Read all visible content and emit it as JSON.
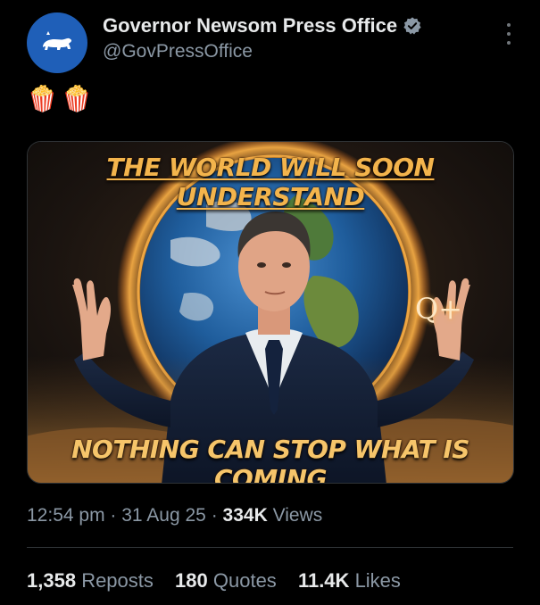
{
  "account": {
    "display_name": "Governor Newsom Press Office",
    "handle": "@GovPressOffice",
    "verified": true,
    "avatar_icon": "california-bear-icon",
    "avatar_color": "#1f5fb8"
  },
  "post": {
    "text": "🍿🍿"
  },
  "media": {
    "caption_top": "THE WORLD WILL SOON UNDERSTAND",
    "caption_bottom": "NOTHING CAN STOP WHAT IS COMING",
    "badge": "Q+"
  },
  "meta": {
    "time": "12:54 pm",
    "separator": "·",
    "date": "31 Aug 25",
    "views_count": "334K",
    "views_label": "Views"
  },
  "stats": {
    "reposts_count": "1,358",
    "reposts_label": "Reposts",
    "quotes_count": "180",
    "quotes_label": "Quotes",
    "likes_count": "11.4K",
    "likes_label": "Likes"
  },
  "colors": {
    "background": "#000000",
    "primary_text": "#e7e9ea",
    "secondary_text": "#8b98a5",
    "verified_badge": "#8b98a5",
    "caption_gold": "#f3b44c"
  }
}
